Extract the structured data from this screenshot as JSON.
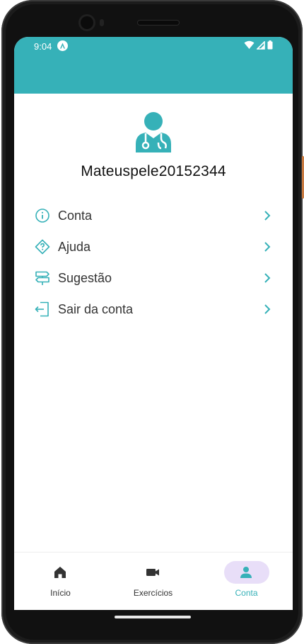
{
  "status_bar": {
    "time": "9:04"
  },
  "profile": {
    "username": "Mateuspele20152344",
    "avatar_icon": "doctor-avatar-icon"
  },
  "menu": {
    "items": [
      {
        "label": "Conta",
        "icon": "info-icon"
      },
      {
        "label": "Ajuda",
        "icon": "help-diamond-icon"
      },
      {
        "label": "Sugestão",
        "icon": "signpost-icon"
      },
      {
        "label": "Sair da conta",
        "icon": "logout-icon"
      }
    ]
  },
  "bottom_nav": {
    "items": [
      {
        "label": "Início",
        "icon": "home-icon"
      },
      {
        "label": "Exercícios",
        "icon": "video-camera-icon"
      },
      {
        "label": "Conta",
        "icon": "person-icon",
        "active": true
      }
    ]
  },
  "colors": {
    "accent": "#36b1b8",
    "active_pill": "#e8def8",
    "text": "#333333"
  }
}
